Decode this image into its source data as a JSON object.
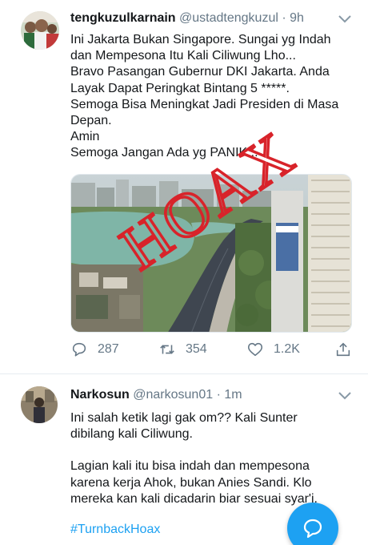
{
  "tweet1": {
    "display_name": "tengkuzulkarnain",
    "handle": "@ustadtengkuzul",
    "time": "· 9h",
    "lines": [
      "Ini Jakarta Bukan Singapore. Sungai yg Indah",
      "dan Mempesona Itu Kali Ciliwung Lho...",
      "Bravo Pasangan Gubernur DKI Jakarta. Anda",
      "Layak Dapat Peringkat Bintang 5 *****.",
      "Semoga Bisa Meningkat Jadi Presiden di Masa",
      "Depan.",
      "Amin",
      "Semoga Jangan Ada yg PANIK..."
    ],
    "stamp": "HOAX",
    "stamp_color": "#d8232a",
    "reply_count": "287",
    "retweet_count": "354",
    "like_count": "1.2K"
  },
  "tweet2": {
    "display_name": "Narkosun",
    "handle": "@narkosun01",
    "time": "· 1m",
    "lines": [
      "Ini salah ketik lagi gak om?? Kali Sunter",
      "dibilang kali Ciliwung.",
      "",
      "Lagian kali itu bisa indah dan mempesona",
      "karena kerja Ahok, bukan Anies Sandi. Klo",
      "mereka kan kali dicadarin biar sesuai syar'i."
    ],
    "hashtag": "#TurnbackHoax"
  },
  "colors": {
    "accent": "#1da1f2",
    "muted": "#657786",
    "text": "#14171a"
  }
}
